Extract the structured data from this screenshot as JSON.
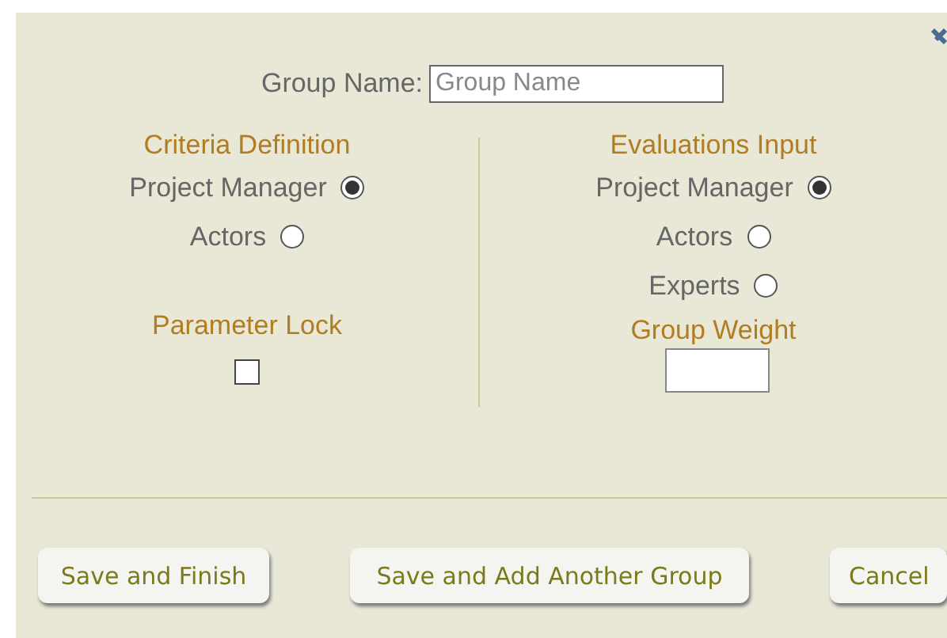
{
  "group_name": {
    "label": "Group Name:",
    "placeholder": "Group Name"
  },
  "criteria_definition": {
    "title": "Criteria Definition",
    "options": [
      {
        "label": "Project Manager",
        "selected": true
      },
      {
        "label": "Actors",
        "selected": false
      }
    ]
  },
  "parameter_lock": {
    "title": "Parameter Lock",
    "checked": false
  },
  "evaluations_input": {
    "title": "Evaluations Input",
    "options": [
      {
        "label": "Project Manager",
        "selected": true
      },
      {
        "label": "Actors",
        "selected": false
      },
      {
        "label": "Experts",
        "selected": false
      }
    ]
  },
  "group_weight": {
    "title": "Group Weight"
  },
  "buttons": [
    "Save and Finish",
    "Save and Add Another Group",
    "Cancel"
  ]
}
